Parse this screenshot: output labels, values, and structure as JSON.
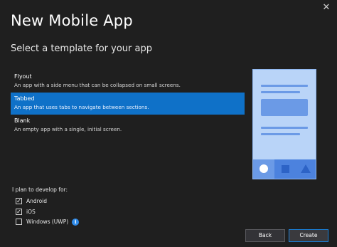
{
  "window": {
    "close_glyph": "✕"
  },
  "title": "New Mobile App",
  "subtitle": "Select a template for your app",
  "templates": [
    {
      "name": "Flyout",
      "description": "An app with a side menu that can be collapsed on small screens.",
      "selected": false
    },
    {
      "name": "Tabbed",
      "description": "An app that uses tabs to navigate between sections.",
      "selected": true
    },
    {
      "name": "Blank",
      "description": "An empty app with a single, initial screen.",
      "selected": false
    }
  ],
  "platforms": {
    "label": "I plan to develop for:",
    "items": [
      {
        "label": "Android",
        "checked": true
      },
      {
        "label": "iOS",
        "checked": true
      },
      {
        "label": "Windows (UWP)",
        "checked": false
      }
    ],
    "info_icon_glyph": "i"
  },
  "buttons": {
    "back": "Back",
    "create": "Create"
  },
  "colors": {
    "accent": "#0f71c8",
    "preview_bg": "#b9d4f8",
    "preview_tabbar": "#4c82de"
  }
}
